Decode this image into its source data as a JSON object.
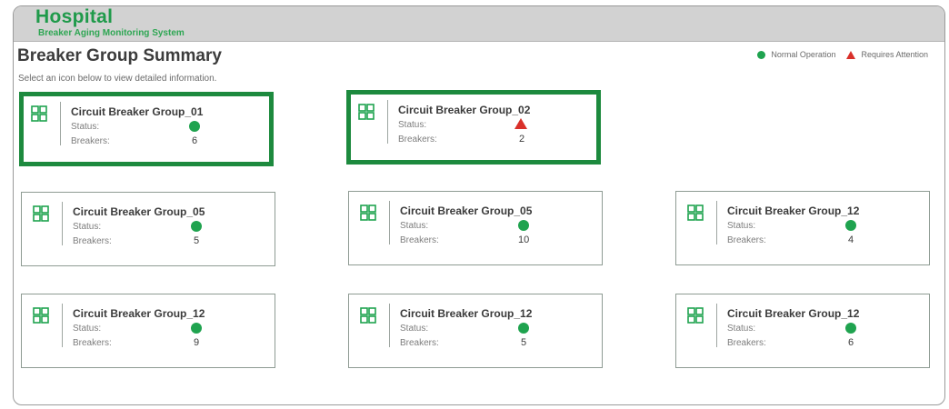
{
  "header": {
    "title": "Hospital",
    "subtitle": "Breaker Aging Monitoring System"
  },
  "page": {
    "title": "Breaker Group Summary",
    "instructions": "Select an icon below to view detailed information."
  },
  "legend": {
    "normal_label": "Normal Operation",
    "attention_label": "Requires Attention",
    "normal_color": "#1fa34f",
    "attention_color": "#d9302a"
  },
  "labels": {
    "status": "Status:",
    "breakers": "Breakers:"
  },
  "cards": [
    {
      "name": "Circuit Breaker Group_01",
      "status": "normal",
      "breakers": "6",
      "selected": true
    },
    {
      "name": "Circuit Breaker Group_02",
      "status": "attention",
      "breakers": "2",
      "selected": true
    },
    {
      "name": "Circuit Breaker Group_05",
      "status": "normal",
      "breakers": "5",
      "selected": false
    },
    {
      "name": "Circuit Breaker Group_05",
      "status": "normal",
      "breakers": "10",
      "selected": false
    },
    {
      "name": "Circuit Breaker Group_12",
      "status": "normal",
      "breakers": "4",
      "selected": false
    },
    {
      "name": "Circuit Breaker Group_12",
      "status": "normal",
      "breakers": "9",
      "selected": false
    },
    {
      "name": "Circuit Breaker Group_12",
      "status": "normal",
      "breakers": "5",
      "selected": false
    },
    {
      "name": "Circuit Breaker Group_12",
      "status": "normal",
      "breakers": "6",
      "selected": false
    }
  ]
}
